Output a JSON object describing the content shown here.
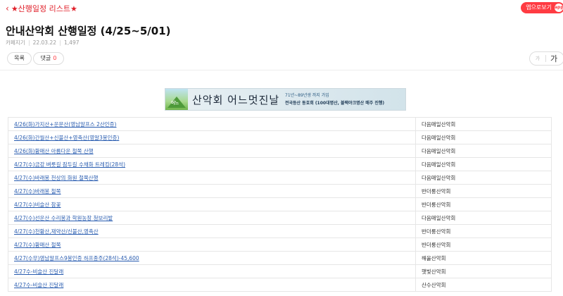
{
  "header": {
    "back_label": "★산행일정 리스트★",
    "pc_view_label": "앱으로보기",
    "pc_view_knob": "app"
  },
  "post": {
    "title": "안내산악회 산행일정 (4/25~5/01)",
    "author": "카페지기",
    "date": "22.03.22",
    "views": "1,497"
  },
  "actions": {
    "list_label": "목록",
    "comment_label": "댓글",
    "comment_count": "0",
    "font_small": "가",
    "font_large": "가"
  },
  "banner": {
    "slogan": "산악회 어느멋진날",
    "line1": "71년~89년생 까지 가입",
    "line2": "전국등산 동호회 (100대명산, 블랙야크명산 매주 진행)",
    "logo_text": "어느"
  },
  "schedule": [
    {
      "trip": "4/26(화)가지산+운문산(영남알프스 2산인증)",
      "club": "다음매일산악회"
    },
    {
      "trip": "4/26(화)간월산+신불산+영축산(영알3봉인증)",
      "club": "다음매일산악회"
    },
    {
      "trip": "4/26(화)황매산 아름다운 철쭉 산행",
      "club": "다음매일산악회"
    },
    {
      "trip": "4/27(수)금강 벼룻길 잠두길 수채화 트레킹(28석)",
      "club": "다음매일산악회"
    },
    {
      "trip": "4/27(수)바래봉 천상의 화원 철쭉산행",
      "club": "다음매일산악회"
    },
    {
      "trip": "4/27(수)바래봉 철쭉",
      "club": "반더룽산악회"
    },
    {
      "trip": "4/27(수)비슬산 참꽃",
      "club": "반더룽산악회"
    },
    {
      "trip": "4/27(수)선운산 수리봉과 학원농장 청보리밭",
      "club": "다음매일산악회"
    },
    {
      "trip": "4/27(수)천황산,재약산/신불산,영축산",
      "club": "반더룽산악회"
    },
    {
      "trip": "4/27(수)황매산 철쭉",
      "club": "반더룽산악회"
    },
    {
      "trip": "4/27(수무)영남알프스9봉인증 하프종주(28석)-45,600",
      "club": "해울산악회"
    },
    {
      "trip": "4/27수-비슬산 진달래",
      "club": "햇빛산악회"
    },
    {
      "trip": "4/27수-비슬산 진달래",
      "club": "산수산악회"
    }
  ]
}
